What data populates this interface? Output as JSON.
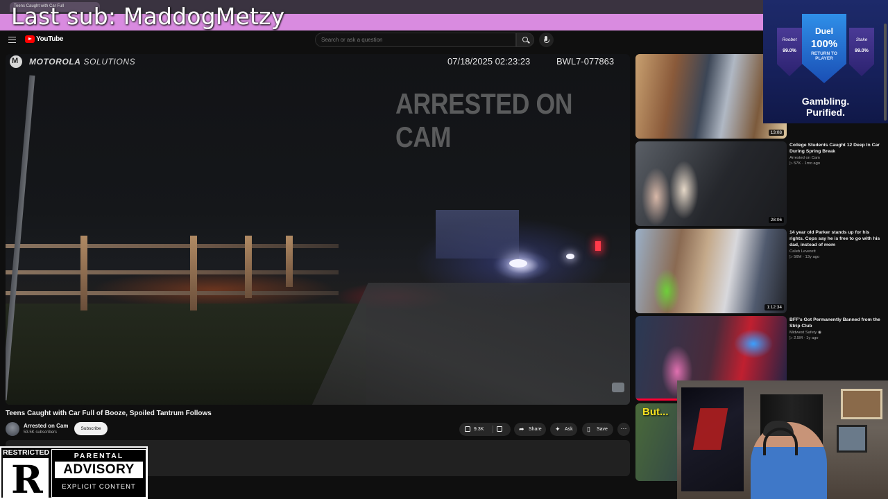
{
  "browser": {
    "tab_title": "Teens Caught with Car Full"
  },
  "stream_banner": {
    "text": "Last sub: MaddogMetzy"
  },
  "header": {
    "brand": "YouTube",
    "search_placeholder": "Search or ask a question"
  },
  "player": {
    "camera_brand_bold": "MOTOROLA",
    "camera_brand_light": " SOLUTIONS",
    "timestamp": "07/18/2025 02:23:23",
    "device_id": "BWL7-077863",
    "watermark": "ARRESTED ON CAM"
  },
  "video": {
    "title": "Teens Caught with Car Full of Booze, Spoiled Tantrum Follows",
    "channel": "Arrested on Cam",
    "subscribers": "53.5K subscribers",
    "subscribe_label": "Subscribe",
    "likes": "9.3K",
    "share_label": "Share",
    "ask_label": "Ask",
    "save_label": "Save"
  },
  "rating_overlay": {
    "restricted": "RESTRICTED",
    "r_letter": "R",
    "pa_top": "PARENTAL",
    "pa_mid": "ADVISORY",
    "pa_bottom": "EXPLICIT CONTENT"
  },
  "recommendations": [
    {
      "title": "",
      "channel": "",
      "meta": "",
      "duration": "13:08"
    },
    {
      "title": "College Students Caught 12 Deep In Car During Spring Break",
      "channel": "Arrested on Cam",
      "meta": "▷ 57K · 1mo ago",
      "duration": "28:06"
    },
    {
      "title": "14 year old Parker stands up for his rights. Cops say he is free to go with his dad, instead of mom",
      "channel": "Caleb Leverett",
      "meta": "▷ 56M · 13y ago",
      "duration": "1:12:34"
    },
    {
      "title": "BFF's Got Permanently Banned from the Strip Club",
      "channel": "Midwest Safety ◉",
      "meta": "▷ 2.5M · 1y ago",
      "duration": ""
    },
    {
      "overlay_text": "But..."
    }
  ],
  "ad": {
    "center_title": "Duel",
    "center_pct": "100%",
    "center_sub": "RETURN TO PLAYER",
    "left_name": "Roobet",
    "left_pct": "99.0%",
    "right_name": "Stake",
    "right_pct": "99.0%",
    "tagline_1": "Gambling.",
    "tagline_2": "Purified."
  },
  "colors": {
    "banner": "#d98be0",
    "youtube_red": "#ff0000",
    "background": "#0f0f0f",
    "progress": "#ff0033"
  }
}
